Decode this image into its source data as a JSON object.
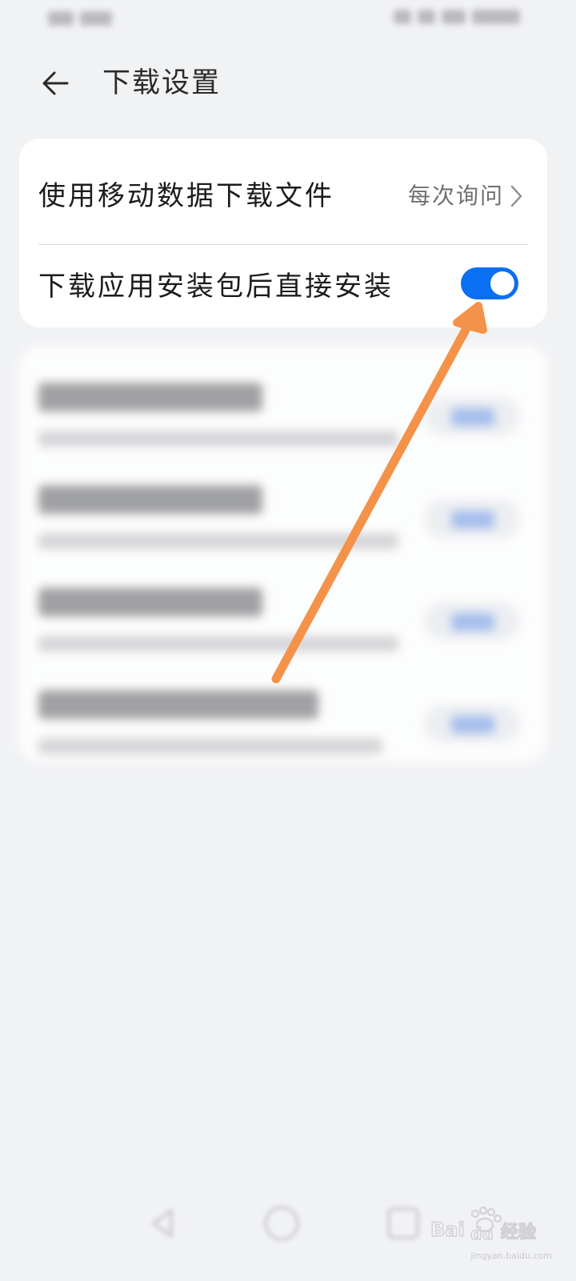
{
  "header": {
    "title": "下载设置"
  },
  "settings": {
    "mobile_data_label": "使用移动数据下载文件",
    "mobile_data_value": "每次询问",
    "auto_install_label": "下载应用安装包后直接安装",
    "auto_install_enabled": true
  },
  "colors": {
    "accent": "#0a6ff2",
    "annotation_arrow": "#f5924a",
    "background": "#f1f2f4"
  },
  "watermark": {
    "brand": "Bai du 经验",
    "url": "jingyan.baidu.com"
  }
}
